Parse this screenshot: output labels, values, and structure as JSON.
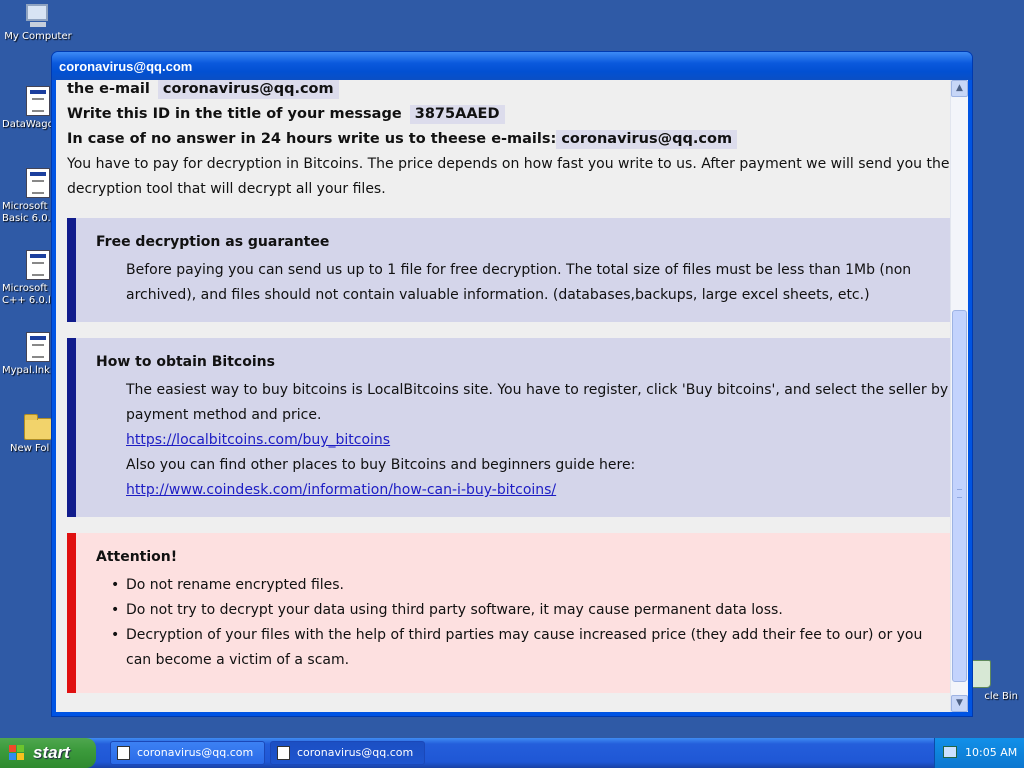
{
  "desktop": {
    "icons": [
      {
        "label": "My Computer"
      },
      {
        "label": "DataWago"
      },
      {
        "label": "Microsoft '\nBasic 6.0."
      },
      {
        "label": "Microsoft '\nC++ 6.0.l"
      },
      {
        "label": "Mypal.lnk."
      },
      {
        "label": "New Fol"
      },
      {
        "label": "cle Bin"
      }
    ]
  },
  "window": {
    "title": "coronavirus@qq.com"
  },
  "note": {
    "email_prefix": "the e-mail",
    "email": "coronavirus@qq.com",
    "id_prefix": "Write this ID in the title of your message",
    "id": "3875AAED",
    "backup_prefix": "In case of no answer in 24 hours write us to theese e-mails:",
    "backup_email": "coronavirus@qq.com",
    "payment_text": "You have to pay for decryption in Bitcoins. The price depends on how fast you write to us. After payment we will send you the decryption tool that will decrypt all your files.",
    "guarantee": {
      "title": "Free decryption as guarantee",
      "text": "Before paying you can send us up to 1 file for free decryption. The total size of files must be less than 1Mb (non archived), and files should not contain valuable information. (databases,backups, large excel sheets, etc.)"
    },
    "bitcoins": {
      "title": "How to obtain Bitcoins",
      "text": "The easiest way to buy bitcoins is LocalBitcoins site. You have to register, click 'Buy bitcoins', and select the seller by payment method and price.",
      "link1": "https://localbitcoins.com/buy_bitcoins",
      "text2": "Also you can find other places to buy Bitcoins and beginners guide here:",
      "link2": "http://www.coindesk.com/information/how-can-i-buy-bitcoins/"
    },
    "attention": {
      "title": "Attention!",
      "items": [
        "Do not rename encrypted files.",
        "Do not try to decrypt your data using third party software, it may cause permanent data loss.",
        "Decryption of your files with the help of third parties may cause increased price (they add their fee to our) or you can become a victim of a scam."
      ]
    }
  },
  "taskbar": {
    "start_label": "start",
    "tasks": [
      {
        "label": "coronavirus@qq.com"
      },
      {
        "label": "coronavirus@qq.com"
      }
    ],
    "clock": "10:05 AM"
  },
  "colors": {
    "desktop": "#2f5aa6",
    "info_box": "#d4d5ea",
    "info_bar": "#111c8c",
    "warn_box": "#fde0e0",
    "warn_bar": "#e01010"
  }
}
